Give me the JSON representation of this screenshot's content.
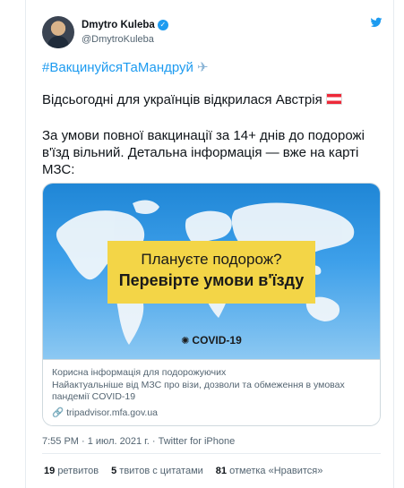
{
  "tweet": {
    "author_name": "Dmytro Kuleba",
    "handle": "@DmytroKuleba",
    "hashtag": "#ВакцинуйсяТаМандруй",
    "line1": "Відсьогодні для українців відкрилася Австрія",
    "para2": "За умови повної вакцинації за 14+ днів до подорожі в'їзд вільний. Детальна інформація — вже на карті МЗС:",
    "meta": "7:55 PM · 1 июл. 2021 г. · Twitter for iPhone"
  },
  "media": {
    "banner_line1": "Плануєте подорож?",
    "banner_line2": "Перевірте умови в'їзду",
    "covid_label": "COVID-19",
    "card_title": "Корисна інформація для подорожуючих",
    "card_desc": "Найактуальніше від МЗС про візи, дозволи та обмеження в умовах пандемії COVID-19",
    "card_domain": "tripadvisor.mfa.gov.ua"
  },
  "stats": {
    "retweets_count": "19",
    "retweets_label": "ретвитов",
    "quotes_count": "5",
    "quotes_label": "твитов с цитатами",
    "likes_count": "81",
    "likes_label": "отметка «Нравится»"
  },
  "colors": {
    "accent": "#1d9bf0",
    "banner": "#f3d547",
    "flag_red": "#ed2939"
  },
  "icons": [
    "verified-badge-icon",
    "twitter-logo-icon",
    "airplane-icon",
    "austria-flag-icon",
    "virus-icon",
    "link-icon"
  ]
}
